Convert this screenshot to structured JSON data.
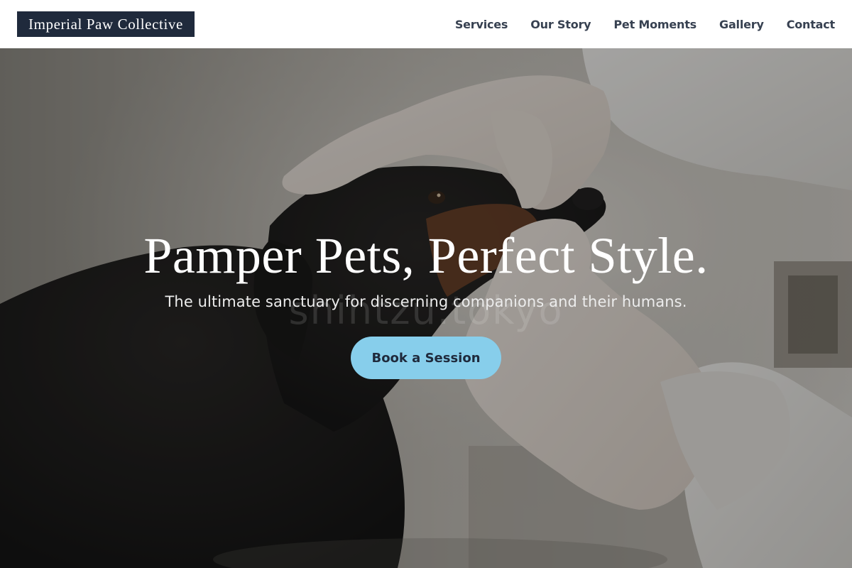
{
  "header": {
    "brand": "Imperial Paw Collective",
    "nav": [
      {
        "label": "Services"
      },
      {
        "label": "Our Story"
      },
      {
        "label": "Pet Moments"
      },
      {
        "label": "Gallery"
      },
      {
        "label": "Contact"
      }
    ]
  },
  "hero": {
    "title": "Pamper Pets, Perfect Style.",
    "subtitle": "The ultimate sanctuary for discerning companions and their humans.",
    "watermark": "shihtzu.tokyo",
    "cta_label": "Book a Session",
    "photo_description": "Gloved veterinarian hands examining a black and tan dachshund's mouth"
  },
  "colors": {
    "brand_bg": "#1f2a3c",
    "accent": "#87ceeb",
    "nav_text": "#374151"
  }
}
